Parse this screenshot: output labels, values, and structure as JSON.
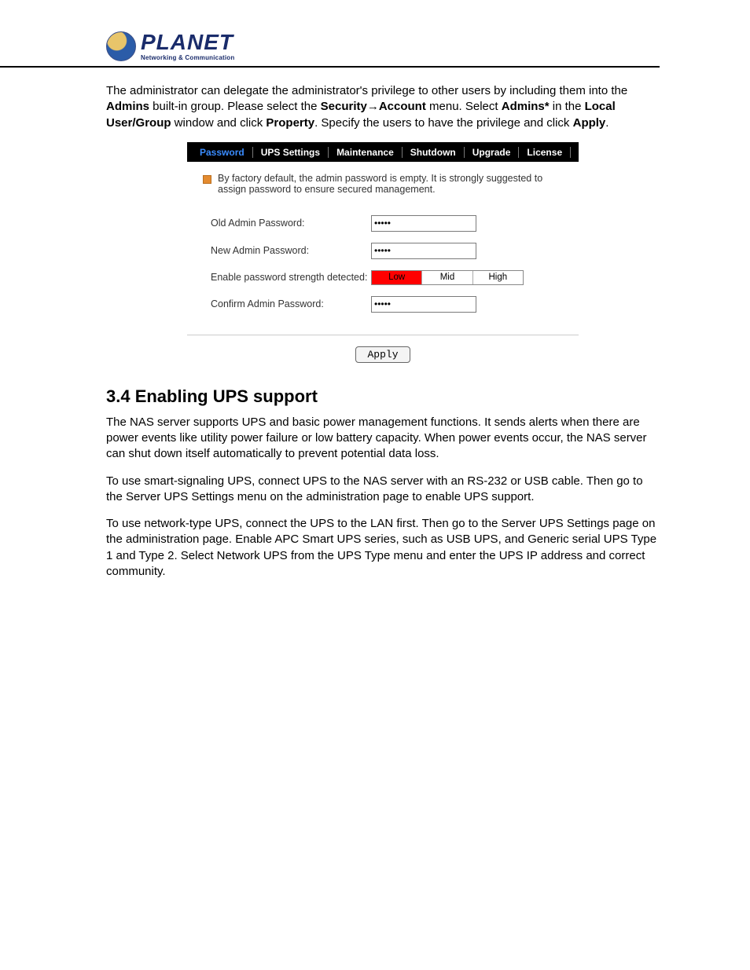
{
  "logo": {
    "name": "PLANET",
    "tagline": "Networking & Communication"
  },
  "intro": {
    "p1a": "The administrator can delegate the administrator's privilege to other users by including them into the ",
    "p1b": "Admins",
    "p1c": " built-in group. Please select the ",
    "p1d": "Security",
    "p1e": "→",
    "p1f": "Account",
    "p1g": " menu. Select ",
    "p1h": "Admins*",
    "p1i": " in the ",
    "p1j": "Local User/Group",
    "p1k": " window and click ",
    "p1l": "Property",
    "p1m": ". Specify the users to have the privilege and click ",
    "p1n": "Apply",
    "p1o": "."
  },
  "tabs": {
    "password": "Password",
    "ups": "UPS Settings",
    "maintenance": "Maintenance",
    "shutdown": "Shutdown",
    "upgrade": "Upgrade",
    "license": "License"
  },
  "notice": "By factory default, the admin password is empty. It is strongly suggested to assign password to ensure secured management.",
  "form": {
    "old_label": "Old Admin Password:",
    "new_label": "New Admin Password:",
    "strength_label": "Enable password strength detected:",
    "confirm_label": "Confirm Admin Password:",
    "old_value": "•••••",
    "new_value": "•••••",
    "confirm_value": "•••••",
    "strength": {
      "low": "Low",
      "mid": "Mid",
      "high": "High"
    },
    "apply": "Apply"
  },
  "section": {
    "heading": "3.4 Enabling UPS support",
    "p1": "The NAS server supports UPS and basic power management functions. It sends alerts when there are power events like utility power failure or low battery capacity. When power events occur, the NAS server can shut down itself automatically to prevent potential data loss.",
    "p2": "To use smart-signaling UPS, connect UPS to the NAS server with an RS-232 or USB cable. Then go to the Server UPS Settings menu on the administration page to enable UPS support.",
    "p3": "To use network-type UPS, connect the UPS to the LAN first. Then go to the Server UPS Settings page on the administration page. Enable APC Smart UPS series, such as USB UPS, and Generic serial UPS Type 1 and Type 2. Select Network UPS from the UPS Type menu and enter the UPS IP address and correct community."
  }
}
